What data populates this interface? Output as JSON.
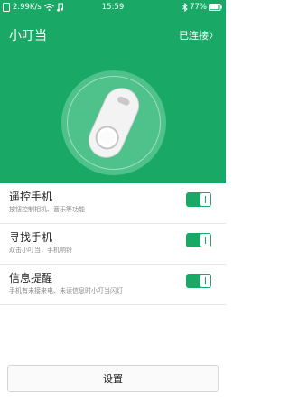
{
  "status_bar": {
    "network_speed": "2.99K/s",
    "time": "15:59",
    "battery": "77%",
    "icons": [
      "phone-icon",
      "wifi-icon",
      "music-note-icon",
      "bluetooth-icon",
      "battery-icon"
    ]
  },
  "header": {
    "app_title": "小叮当",
    "connection_status": "已连接〉"
  },
  "colors": {
    "accent": "#19a866",
    "circle": "#4fc28c"
  },
  "settings": [
    {
      "title": "遥控手机",
      "description": "按钮控制相机、音乐等功能",
      "enabled": true
    },
    {
      "title": "寻找手机",
      "description": "双击小叮当，手机响铃",
      "enabled": true
    },
    {
      "title": "信息提醒",
      "description": "手机有未接来电、未读信息时小叮当闪灯",
      "enabled": true
    }
  ],
  "footer": {
    "settings_label": "设置"
  }
}
